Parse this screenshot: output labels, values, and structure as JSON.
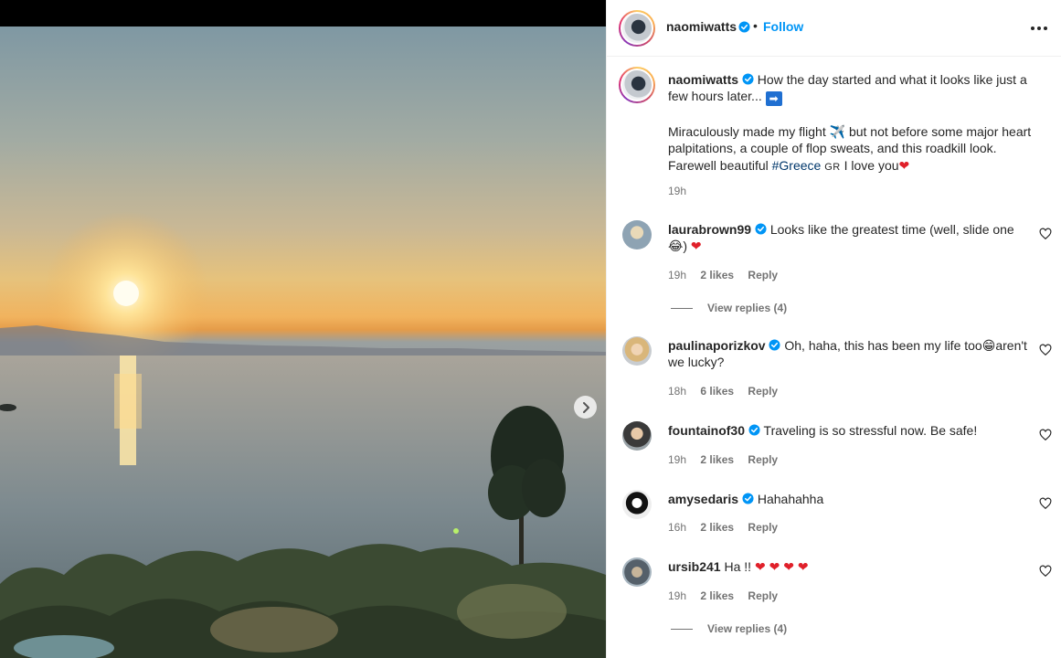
{
  "post": {
    "username": "naomiwatts",
    "follow_label": "Follow",
    "dot": "•",
    "more_icon": "more-horizontal-icon"
  },
  "caption": {
    "username": "naomiwatts",
    "line1": "How the day started and what it looks like just a few hours later...",
    "arrow": "➡",
    "para2_a": "Miraculously made my flight",
    "plane": "✈️",
    "para2_b": "but not before some major heart palpitations, a couple of flop sweats, and this roadkill look. Farewell beautiful",
    "hashtag": "#Greece",
    "flag": "GR",
    "para2_c": "I love you",
    "heart": "❤",
    "time": "19h"
  },
  "comments": [
    {
      "username": "laurabrown99",
      "text": "Looks like the greatest time (well, slide one",
      "text_end": ")",
      "emoji": "😂",
      "heart": "❤",
      "time": "19h",
      "likes": "2 likes",
      "reply": "Reply",
      "view_replies": "View replies (4)"
    },
    {
      "username": "paulinaporizkov",
      "text": "Oh, haha, this has been my life too",
      "emoji": "😁",
      "text_end": "aren't we lucky?",
      "time": "18h",
      "likes": "6 likes",
      "reply": "Reply"
    },
    {
      "username": "fountainof30",
      "text": "Traveling is so stressful now. Be safe!",
      "time": "19h",
      "likes": "2 likes",
      "reply": "Reply"
    },
    {
      "username": "amysedaris",
      "text": "Hahahahha",
      "time": "16h",
      "likes": "2 likes",
      "reply": "Reply"
    },
    {
      "username": "ursib241",
      "text": "Ha !!",
      "hearts": "❤ ❤ ❤ ❤",
      "time": "19h",
      "likes": "2 likes",
      "reply": "Reply",
      "view_replies": "View replies (4)"
    }
  ],
  "colors": {
    "accent": "#0095f6",
    "hashtag": "#00376b",
    "heart": "#e0202a",
    "muted": "#737373"
  }
}
